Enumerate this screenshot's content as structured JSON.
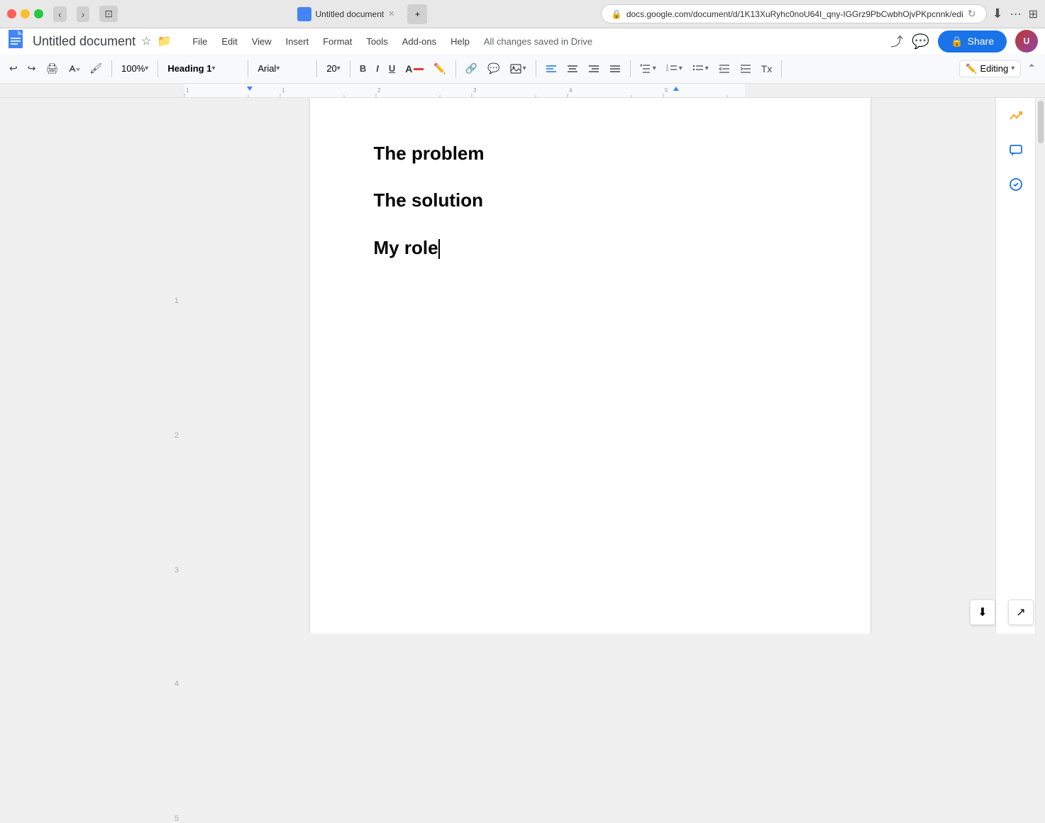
{
  "titlebar": {
    "traffic_lights": [
      "red",
      "yellow",
      "green"
    ],
    "url": "docs.google.com/document/d/1K13XuRyhc0noU64I_qny-IGGrz9PbCwbhOjvPKpcnnk/edi",
    "favicon_label": "U"
  },
  "appbar": {
    "doc_title": "Untitled document",
    "save_status": "All changes saved in Drive",
    "menu_items": [
      "File",
      "Edit",
      "View",
      "Insert",
      "Format",
      "Tools",
      "Add-ons",
      "Help"
    ],
    "share_label": "Share"
  },
  "toolbar": {
    "zoom": "100%",
    "heading_style": "Heading 1",
    "font": "Arial",
    "font_size": "20",
    "editing_mode": "Editing"
  },
  "document": {
    "headings": [
      {
        "text": "The problem"
      },
      {
        "text": "The solution"
      },
      {
        "text": "My role"
      }
    ]
  },
  "sidebar": {
    "icons": [
      "trending-up",
      "comment",
      "spell-check",
      "circle-check"
    ]
  }
}
